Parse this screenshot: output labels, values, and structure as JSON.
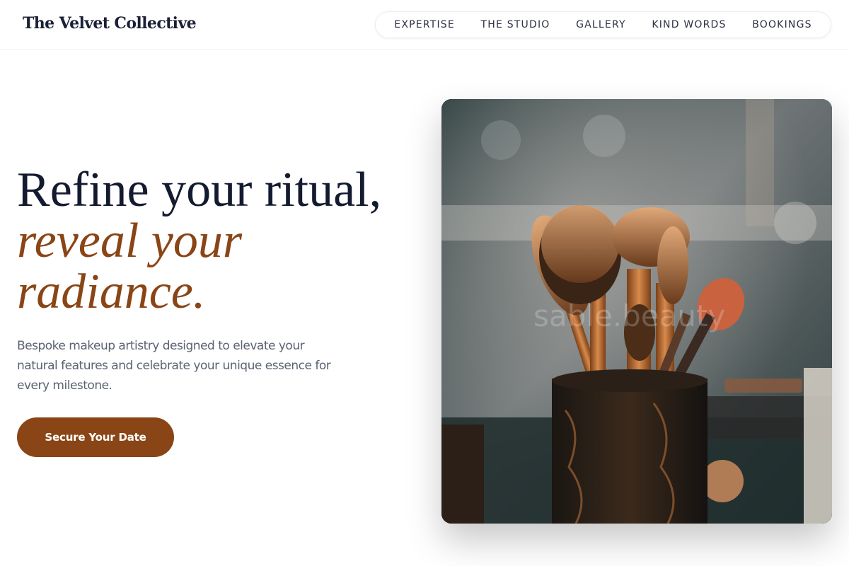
{
  "header": {
    "brand": "The Velvet Collective",
    "nav": [
      "EXPERTISE",
      "THE STUDIO",
      "GALLERY",
      "KIND WORDS",
      "BOOKINGS"
    ]
  },
  "hero": {
    "title_line1": "Refine your ritual,",
    "title_accent_line1": "reveal your",
    "title_accent_line2": "radiance.",
    "subtitle": "Bespoke makeup artistry designed to elevate your natural features and celebrate your unique essence for every milestone.",
    "cta_label": "Secure Your Date",
    "image_watermark": "sable.beauty"
  },
  "colors": {
    "accent": "#8a4516",
    "heading": "#141a30",
    "body_text": "#5b6272"
  },
  "icons": {
    "hero_image": "makeup-brushes-photo"
  }
}
